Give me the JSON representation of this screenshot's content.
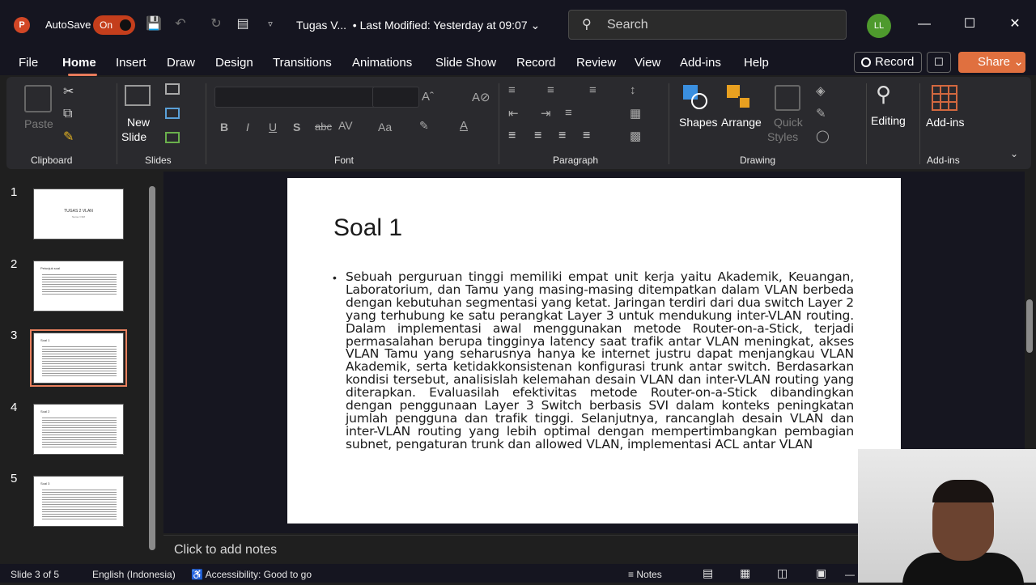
{
  "titlebar": {
    "autosave_label": "AutoSave",
    "autosave_state": "On",
    "doc_title": "Tugas V...",
    "last_modified": "•  Last Modified: Yesterday at 09:07",
    "search_placeholder": "Search",
    "user_initials": "LL"
  },
  "menu": {
    "items": [
      "File",
      "Home",
      "Insert",
      "Draw",
      "Design",
      "Transitions",
      "Animations",
      "Slide Show",
      "Record",
      "Review",
      "View",
      "Add-ins",
      "Help"
    ],
    "record_label": "Record",
    "share_label": "Share"
  },
  "ribbon": {
    "clipboard": {
      "paste": "Paste",
      "group": "Clipboard"
    },
    "slides": {
      "new_slide": "New",
      "new_slide2": "Slide",
      "group": "Slides"
    },
    "font": {
      "group": "Font"
    },
    "paragraph": {
      "group": "Paragraph"
    },
    "drawing": {
      "shapes": "Shapes",
      "arrange": "Arrange",
      "quick_styles": "Quick",
      "quick_styles2": "Styles",
      "group": "Drawing"
    },
    "editing": {
      "label": "Editing"
    },
    "addins": {
      "label": "Add-ins",
      "group": "Add-ins"
    }
  },
  "thumbnails": [
    {
      "num": "1",
      "title": "TUGAS 2 VLAN",
      "sub": "Nama / NIM"
    },
    {
      "num": "2",
      "title": "Petunjuk soal"
    },
    {
      "num": "3",
      "title": "Soal 1"
    },
    {
      "num": "4",
      "title": "Soal 2"
    },
    {
      "num": "5",
      "title": "Soal 3"
    }
  ],
  "slide": {
    "title": "Soal 1",
    "body": "Sebuah perguruan tinggi memiliki empat unit kerja yaitu Akademik, Keuangan, Laboratorium, dan Tamu yang masing-masing ditempatkan dalam VLAN berbeda dengan kebutuhan segmentasi yang ketat. Jaringan terdiri dari dua switch Layer 2 yang terhubung ke satu perangkat Layer 3 untuk mendukung inter-VLAN routing. Dalam implementasi awal menggunakan metode Router-on-a-Stick, terjadi permasalahan berupa tingginya latency saat trafik antar VLAN meningkat, akses VLAN Tamu yang seharusnya hanya ke internet justru dapat menjangkau VLAN Akademik, serta ketidakkonsistenan konfigurasi trunk antar switch. Berdasarkan kondisi tersebut, analisislah kelemahan desain VLAN dan inter-VLAN routing yang diterapkan. Evaluasilah efektivitas metode Router-on-a-Stick dibandingkan dengan penggunaan Layer 3 Switch berbasis SVI dalam konteks peningkatan jumlah pengguna dan trafik tinggi. Selanjutnya, rancanglah desain VLAN dan inter-VLAN routing yang lebih optimal dengan mempertimbangkan pembagian subnet, pengaturan trunk dan allowed VLAN, implementasi ACL antar VLAN"
  },
  "notes_placeholder": "Click to add notes",
  "status": {
    "slide_count": "Slide 3 of 5",
    "language": "English (Indonesia)",
    "accessibility": "Accessibility: Good to go",
    "notes": "Notes"
  }
}
